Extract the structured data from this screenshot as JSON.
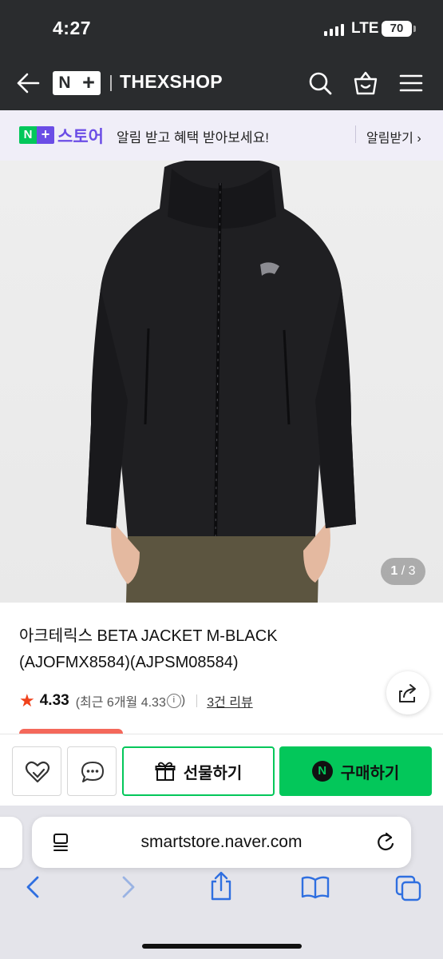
{
  "status_bar": {
    "time": "4:27",
    "network": "LTE",
    "battery": "70"
  },
  "header": {
    "logo_n": "N",
    "logo_plus": "+",
    "shop_name": "THEXSHOP",
    "icons": [
      "back-arrow-icon",
      "search-icon",
      "shopping-bag-icon",
      "hamburger-menu-icon"
    ]
  },
  "banner": {
    "logo_n": "N",
    "logo_plus": "+",
    "brand": "스토어",
    "message": "알림 받고 혜택 받아보세요!",
    "cta": "알림받기 ›",
    "accent_color": "#6b4de6",
    "green_color": "#03c75a"
  },
  "gallery": {
    "current": "1",
    "separator": " / ",
    "total": "3"
  },
  "product": {
    "title": "아크테릭스 BETA JACKET M-BLACK (AJOFMX8584)(AJPSM08584)",
    "rating_star": "★",
    "rating": "4.33",
    "rating_period_prefix": "(최근 6개월 4.33",
    "rating_info": "i",
    "rating_period_suffix": ")",
    "reviews": "3건 리뷰",
    "price_color": "#f24d3e"
  },
  "actions": {
    "gift_label": "선물하기",
    "buy_badge": "N",
    "buy_label": "구매하기",
    "buy_color": "#03c75a"
  },
  "browser": {
    "url": "smartstore.naver.com"
  }
}
